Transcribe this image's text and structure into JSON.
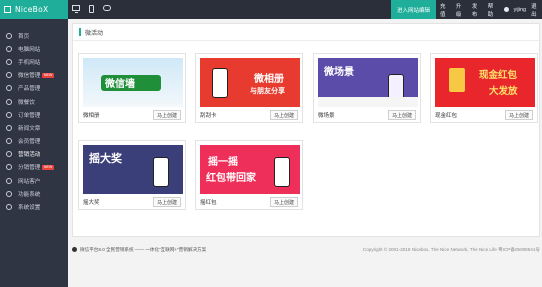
{
  "brand": {
    "logo": "NiceBoX"
  },
  "topbar": {
    "icons": [
      "monitor-icon",
      "phone-icon",
      "chat-icon"
    ],
    "enter_site": "进入网站编辑",
    "links": [
      "充值",
      "升级",
      "发布",
      "帮助"
    ],
    "user": "yijing",
    "logout": "退出"
  },
  "sidebar": {
    "items": [
      {
        "label": "首页",
        "icon": "home-icon",
        "new": ""
      },
      {
        "label": "电脑网站",
        "icon": "pc-icon",
        "new": ""
      },
      {
        "label": "手机网站",
        "icon": "mobile-icon",
        "new": ""
      },
      {
        "label": "微信管理",
        "icon": "wechat-icon",
        "new": "NEW"
      },
      {
        "label": "产品管理",
        "icon": "product-icon",
        "new": ""
      },
      {
        "label": "微餐饮",
        "icon": "food-icon",
        "new": ""
      },
      {
        "label": "订单管理",
        "icon": "order-icon",
        "new": ""
      },
      {
        "label": "新闻文章",
        "icon": "news-icon",
        "new": ""
      },
      {
        "label": "会员管理",
        "icon": "member-icon",
        "new": ""
      },
      {
        "label": "营销活动",
        "icon": "marketing-icon",
        "new": ""
      },
      {
        "label": "分销管理",
        "icon": "distribution-icon",
        "new": "NEW"
      },
      {
        "label": "网站客户",
        "icon": "customer-icon",
        "new": ""
      },
      {
        "label": "功能系统",
        "icon": "function-icon",
        "new": ""
      },
      {
        "label": "系统设置",
        "icon": "settings-icon",
        "new": ""
      }
    ]
  },
  "panel": {
    "title": "微活动"
  },
  "cards": [
    {
      "name": "微相册",
      "button": "马上创建",
      "banner": "微信墙"
    },
    {
      "name": "刮刮卡",
      "button": "马上创建",
      "banner": "微相册",
      "sub": "与朋友分享"
    },
    {
      "name": "微场景",
      "button": "马上创建",
      "banner": "微场景"
    },
    {
      "name": "现金红包",
      "button": "马上创建",
      "banner": "现金红包",
      "sub": "大发放"
    },
    {
      "name": "摇大奖",
      "button": "马上创建",
      "banner": "摇大奖"
    },
    {
      "name": "摇红包",
      "button": "马上创建",
      "banner": "摇一摇",
      "sub": "红包带回家"
    }
  ],
  "footer": {
    "left": "微信平台8.0 全民营销系统 —— 一体化“互联网+”营销解决方案",
    "right": "Copyright © 2001-2018 Nicebox, The Nice Network, The Nice Life 粤ICP备05008541号"
  }
}
